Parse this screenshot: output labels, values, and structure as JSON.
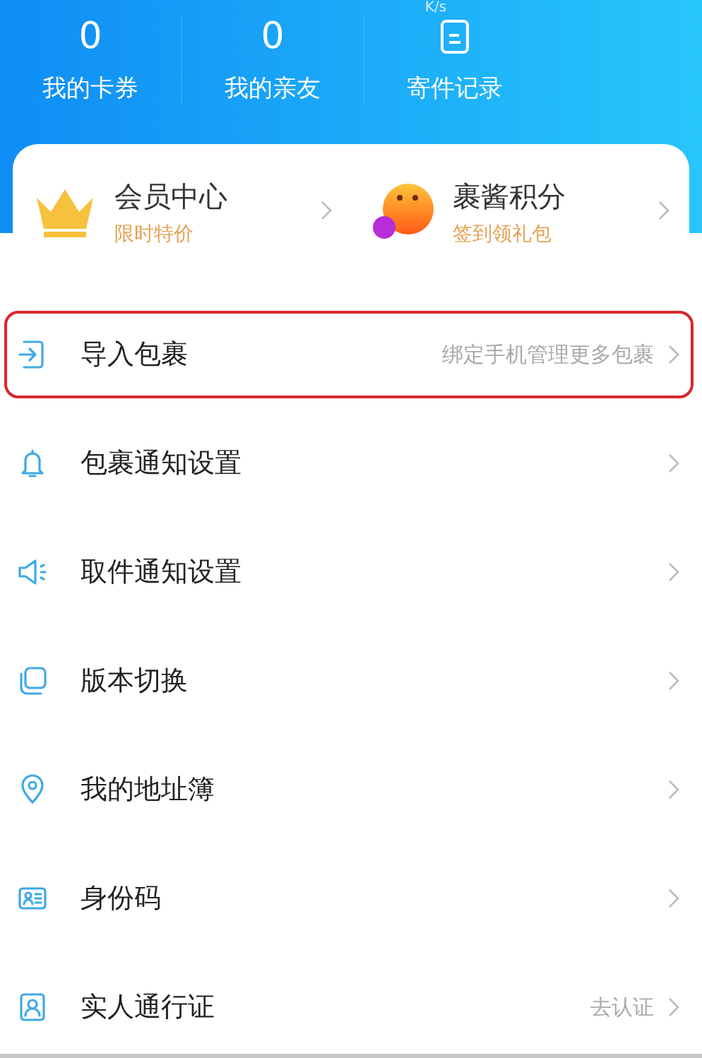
{
  "status_bar": {
    "speed": "K/s"
  },
  "stats": [
    {
      "kind": "number",
      "value": "0",
      "label": "我的卡券"
    },
    {
      "kind": "number",
      "value": "0",
      "label": "我的亲友"
    },
    {
      "kind": "icon",
      "label": "寄件记录"
    }
  ],
  "promos": [
    {
      "kind": "crown",
      "title": "会员中心",
      "subtitle": "限时特价"
    },
    {
      "kind": "mascot",
      "title": "裹酱积分",
      "subtitle": "签到领礼包"
    }
  ],
  "menu": [
    {
      "kind": "import",
      "label": "导入包裹",
      "hint": "绑定手机管理更多包裹",
      "highlighted": true
    },
    {
      "kind": "bell",
      "label": "包裹通知设置",
      "highlighted": false
    },
    {
      "kind": "speaker",
      "label": "取件通知设置",
      "highlighted": false
    },
    {
      "kind": "layers",
      "label": "版本切换",
      "highlighted": false
    },
    {
      "kind": "pin",
      "label": "我的地址簿",
      "highlighted": false
    },
    {
      "kind": "idcard",
      "label": "身份码",
      "highlighted": false
    },
    {
      "kind": "person",
      "label": "实人通行证",
      "hint": "去认证",
      "highlighted": false
    }
  ]
}
